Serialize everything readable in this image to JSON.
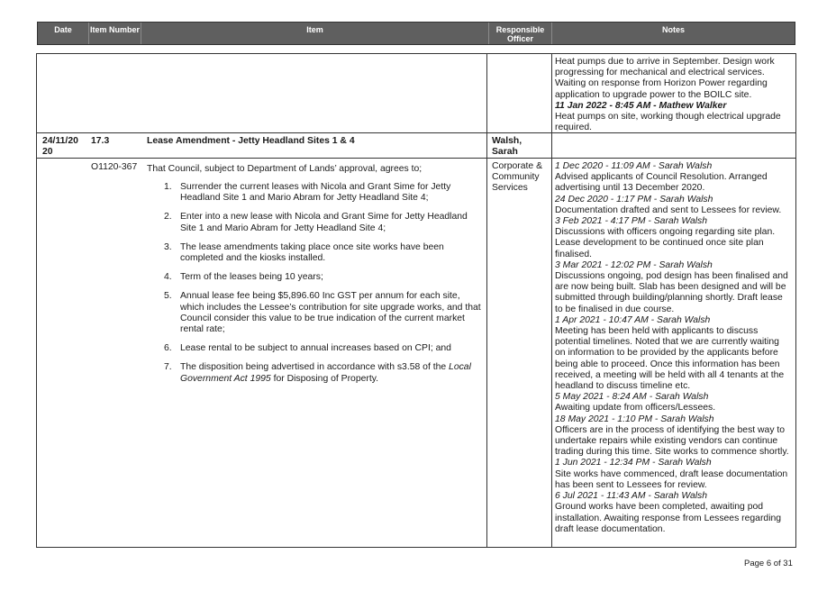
{
  "header": {
    "col_date": "Date",
    "col_item_number": "Item Number",
    "col_item": "Item",
    "col_responsible": "Responsible Officer",
    "col_notes": "Notes"
  },
  "continued_notes": {
    "text1": "Heat pumps due to arrive in September.  Design work progressing for mechanical and electrical services.  Waiting on response from Horizon Power regarding application to upgrade power to the BOILC site.",
    "timestamp": "11 Jan 2022 - 8:45 AM - Mathew Walker",
    "text2": "Heat pumps on site, working though electrical upgrade required."
  },
  "item_row": {
    "date": "24/11/20 20",
    "number": "17.3",
    "title": "Lease Amendment - Jetty Headland Sites 1 & 4",
    "officer": "Walsh, Sarah"
  },
  "resolution": {
    "code": "O1120-367",
    "intro": "That Council, subject to Department of Lands’ approval, agrees to;",
    "department": "Corporate & Community Services",
    "points": [
      {
        "num": "1.",
        "text": "Surrender the current leases with Nicola and Grant Sime for Jetty Headland Site 1 and Mario Abram for Jetty Headland Site 4;"
      },
      {
        "num": "2.",
        "text": "Enter into a new lease with Nicola and Grant Sime for Jetty Headland Site 1 and Mario Abram for Jetty Headland Site 4;"
      },
      {
        "num": "3.",
        "text": "The lease amendments taking place once site works have been completed and the kiosks installed."
      },
      {
        "num": "4.",
        "text": "Term of the leases being 10 years;"
      },
      {
        "num": "5.",
        "text": "Annual lease fee being $5,896.60 Inc GST per annum for each site, which includes the Lessee’s contribution for site upgrade works, and that Council consider this value to be true indication of the current market rental rate;"
      },
      {
        "num": "6.",
        "text": "Lease rental to be subject to annual increases based on CPI; and"
      }
    ],
    "point7_num": "7.",
    "point7_pre": "The disposition being advertised in accordance with s3.58 of the ",
    "point7_italic": "Local Government Act 1995",
    "point7_post": " for Disposing of Property."
  },
  "notes": [
    {
      "ts": "1 Dec 2020 - 11:09 AM - Sarah Walsh",
      "text": "Advised applicants of Council Resolution. Arranged advertising until 13 December 2020."
    },
    {
      "ts": "24 Dec 2020 - 1:17 PM - Sarah Walsh",
      "text": "Documentation drafted and sent to Lessees for review."
    },
    {
      "ts": "3 Feb 2021 - 4:17 PM - Sarah Walsh",
      "text": "Discussions with officers ongoing regarding site plan. Lease development to be continued once site plan finalised."
    },
    {
      "ts": "3 Mar 2021 - 12:02 PM - Sarah Walsh",
      "text": "Discussions ongoing, pod design has been finalised and are now being built. Slab has been designed and will be submitted through building/planning shortly. Draft lease to be finalised in due course."
    },
    {
      "ts": "1 Apr 2021 - 10:47 AM - Sarah Walsh",
      "text": "Meeting has been held with applicants to discuss potential timelines. Noted that we are currently waiting on information to be provided by the applicants before being able to proceed. Once this information has been received, a meeting will be held with all 4 tenants at the headland to discuss timeline etc."
    },
    {
      "ts": "5 May 2021 - 8:24 AM - Sarah Walsh",
      "text": "Awaiting update from officers/Lessees."
    },
    {
      "ts": "18 May 2021 - 1:10 PM - Sarah Walsh",
      "text": "Officers are in the process of identifying the best way to undertake repairs while existing vendors can continue trading during this time. Site works to commence shortly."
    },
    {
      "ts": "1 Jun 2021 - 12:34 PM - Sarah Walsh",
      "text": "Site works have commenced, draft lease documentation has been sent to Lessees for review."
    },
    {
      "ts": "6 Jul 2021 - 11:43 AM - Sarah Walsh",
      "text": "Ground works have been completed, awaiting pod installation. Awaiting response from Lessees regarding draft lease documentation."
    }
  ],
  "footer": {
    "page": "Page 6 of 31"
  }
}
